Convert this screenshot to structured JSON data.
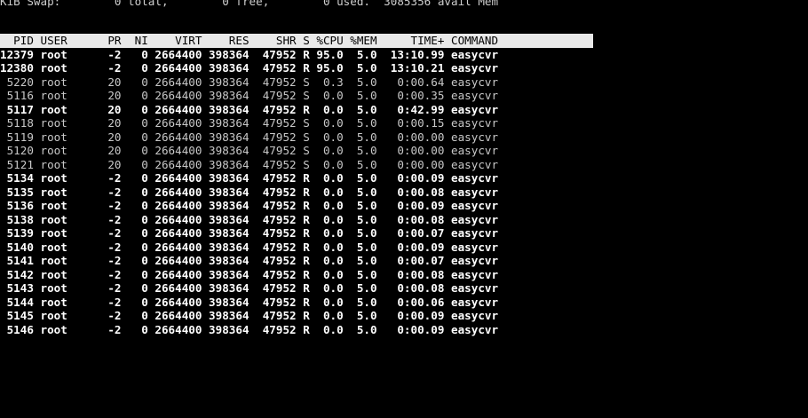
{
  "swap_line": "KiB Swap:        0 total,        0 free,        0 used.  3085356 avail Mem",
  "header": "  PID USER      PR  NI    VIRT    RES    SHR S %CPU %MEM     TIME+ COMMAND",
  "processes": [
    {
      "pid": "12379",
      "user": "root",
      "pr": "-2",
      "ni": "0",
      "virt": "2664400",
      "res": "398364",
      "shr": "47952",
      "s": "R",
      "cpu": "95.0",
      "mem": "5.0",
      "time": "13:10.99",
      "cmd": "easycvr",
      "bold": true
    },
    {
      "pid": "12380",
      "user": "root",
      "pr": "-2",
      "ni": "0",
      "virt": "2664400",
      "res": "398364",
      "shr": "47952",
      "s": "R",
      "cpu": "95.0",
      "mem": "5.0",
      "time": "13:10.21",
      "cmd": "easycvr",
      "bold": true
    },
    {
      "pid": "5220",
      "user": "root",
      "pr": "20",
      "ni": "0",
      "virt": "2664400",
      "res": "398364",
      "shr": "47952",
      "s": "S",
      "cpu": "0.3",
      "mem": "5.0",
      "time": "0:00.64",
      "cmd": "easycvr",
      "bold": false
    },
    {
      "pid": "5116",
      "user": "root",
      "pr": "20",
      "ni": "0",
      "virt": "2664400",
      "res": "398364",
      "shr": "47952",
      "s": "S",
      "cpu": "0.0",
      "mem": "5.0",
      "time": "0:00.35",
      "cmd": "easycvr",
      "bold": false
    },
    {
      "pid": "5117",
      "user": "root",
      "pr": "20",
      "ni": "0",
      "virt": "2664400",
      "res": "398364",
      "shr": "47952",
      "s": "R",
      "cpu": "0.0",
      "mem": "5.0",
      "time": "0:42.99",
      "cmd": "easycvr",
      "bold": true
    },
    {
      "pid": "5118",
      "user": "root",
      "pr": "20",
      "ni": "0",
      "virt": "2664400",
      "res": "398364",
      "shr": "47952",
      "s": "S",
      "cpu": "0.0",
      "mem": "5.0",
      "time": "0:00.15",
      "cmd": "easycvr",
      "bold": false
    },
    {
      "pid": "5119",
      "user": "root",
      "pr": "20",
      "ni": "0",
      "virt": "2664400",
      "res": "398364",
      "shr": "47952",
      "s": "S",
      "cpu": "0.0",
      "mem": "5.0",
      "time": "0:00.00",
      "cmd": "easycvr",
      "bold": false
    },
    {
      "pid": "5120",
      "user": "root",
      "pr": "20",
      "ni": "0",
      "virt": "2664400",
      "res": "398364",
      "shr": "47952",
      "s": "S",
      "cpu": "0.0",
      "mem": "5.0",
      "time": "0:00.00",
      "cmd": "easycvr",
      "bold": false
    },
    {
      "pid": "5121",
      "user": "root",
      "pr": "20",
      "ni": "0",
      "virt": "2664400",
      "res": "398364",
      "shr": "47952",
      "s": "S",
      "cpu": "0.0",
      "mem": "5.0",
      "time": "0:00.00",
      "cmd": "easycvr",
      "bold": false
    },
    {
      "pid": "5134",
      "user": "root",
      "pr": "-2",
      "ni": "0",
      "virt": "2664400",
      "res": "398364",
      "shr": "47952",
      "s": "R",
      "cpu": "0.0",
      "mem": "5.0",
      "time": "0:00.09",
      "cmd": "easycvr",
      "bold": true
    },
    {
      "pid": "5135",
      "user": "root",
      "pr": "-2",
      "ni": "0",
      "virt": "2664400",
      "res": "398364",
      "shr": "47952",
      "s": "R",
      "cpu": "0.0",
      "mem": "5.0",
      "time": "0:00.08",
      "cmd": "easycvr",
      "bold": true
    },
    {
      "pid": "5136",
      "user": "root",
      "pr": "-2",
      "ni": "0",
      "virt": "2664400",
      "res": "398364",
      "shr": "47952",
      "s": "R",
      "cpu": "0.0",
      "mem": "5.0",
      "time": "0:00.09",
      "cmd": "easycvr",
      "bold": true
    },
    {
      "pid": "5138",
      "user": "root",
      "pr": "-2",
      "ni": "0",
      "virt": "2664400",
      "res": "398364",
      "shr": "47952",
      "s": "R",
      "cpu": "0.0",
      "mem": "5.0",
      "time": "0:00.08",
      "cmd": "easycvr",
      "bold": true
    },
    {
      "pid": "5139",
      "user": "root",
      "pr": "-2",
      "ni": "0",
      "virt": "2664400",
      "res": "398364",
      "shr": "47952",
      "s": "R",
      "cpu": "0.0",
      "mem": "5.0",
      "time": "0:00.07",
      "cmd": "easycvr",
      "bold": true
    },
    {
      "pid": "5140",
      "user": "root",
      "pr": "-2",
      "ni": "0",
      "virt": "2664400",
      "res": "398364",
      "shr": "47952",
      "s": "R",
      "cpu": "0.0",
      "mem": "5.0",
      "time": "0:00.09",
      "cmd": "easycvr",
      "bold": true
    },
    {
      "pid": "5141",
      "user": "root",
      "pr": "-2",
      "ni": "0",
      "virt": "2664400",
      "res": "398364",
      "shr": "47952",
      "s": "R",
      "cpu": "0.0",
      "mem": "5.0",
      "time": "0:00.07",
      "cmd": "easycvr",
      "bold": true
    },
    {
      "pid": "5142",
      "user": "root",
      "pr": "-2",
      "ni": "0",
      "virt": "2664400",
      "res": "398364",
      "shr": "47952",
      "s": "R",
      "cpu": "0.0",
      "mem": "5.0",
      "time": "0:00.08",
      "cmd": "easycvr",
      "bold": true
    },
    {
      "pid": "5143",
      "user": "root",
      "pr": "-2",
      "ni": "0",
      "virt": "2664400",
      "res": "398364",
      "shr": "47952",
      "s": "R",
      "cpu": "0.0",
      "mem": "5.0",
      "time": "0:00.08",
      "cmd": "easycvr",
      "bold": true
    },
    {
      "pid": "5144",
      "user": "root",
      "pr": "-2",
      "ni": "0",
      "virt": "2664400",
      "res": "398364",
      "shr": "47952",
      "s": "R",
      "cpu": "0.0",
      "mem": "5.0",
      "time": "0:00.06",
      "cmd": "easycvr",
      "bold": true
    },
    {
      "pid": "5145",
      "user": "root",
      "pr": "-2",
      "ni": "0",
      "virt": "2664400",
      "res": "398364",
      "shr": "47952",
      "s": "R",
      "cpu": "0.0",
      "mem": "5.0",
      "time": "0:00.09",
      "cmd": "easycvr",
      "bold": true
    },
    {
      "pid": "5146",
      "user": "root",
      "pr": "-2",
      "ni": "0",
      "virt": "2664400",
      "res": "398364",
      "shr": "47952",
      "s": "R",
      "cpu": "0.0",
      "mem": "5.0",
      "time": "0:00.09",
      "cmd": "easycvr",
      "bold": true
    }
  ],
  "theme": {
    "background": "#000000",
    "header_bg": "#e9e9e9",
    "header_fg": "#000000",
    "bold_fg": "#ffffff",
    "dim_fg": "#c8c8c8"
  }
}
